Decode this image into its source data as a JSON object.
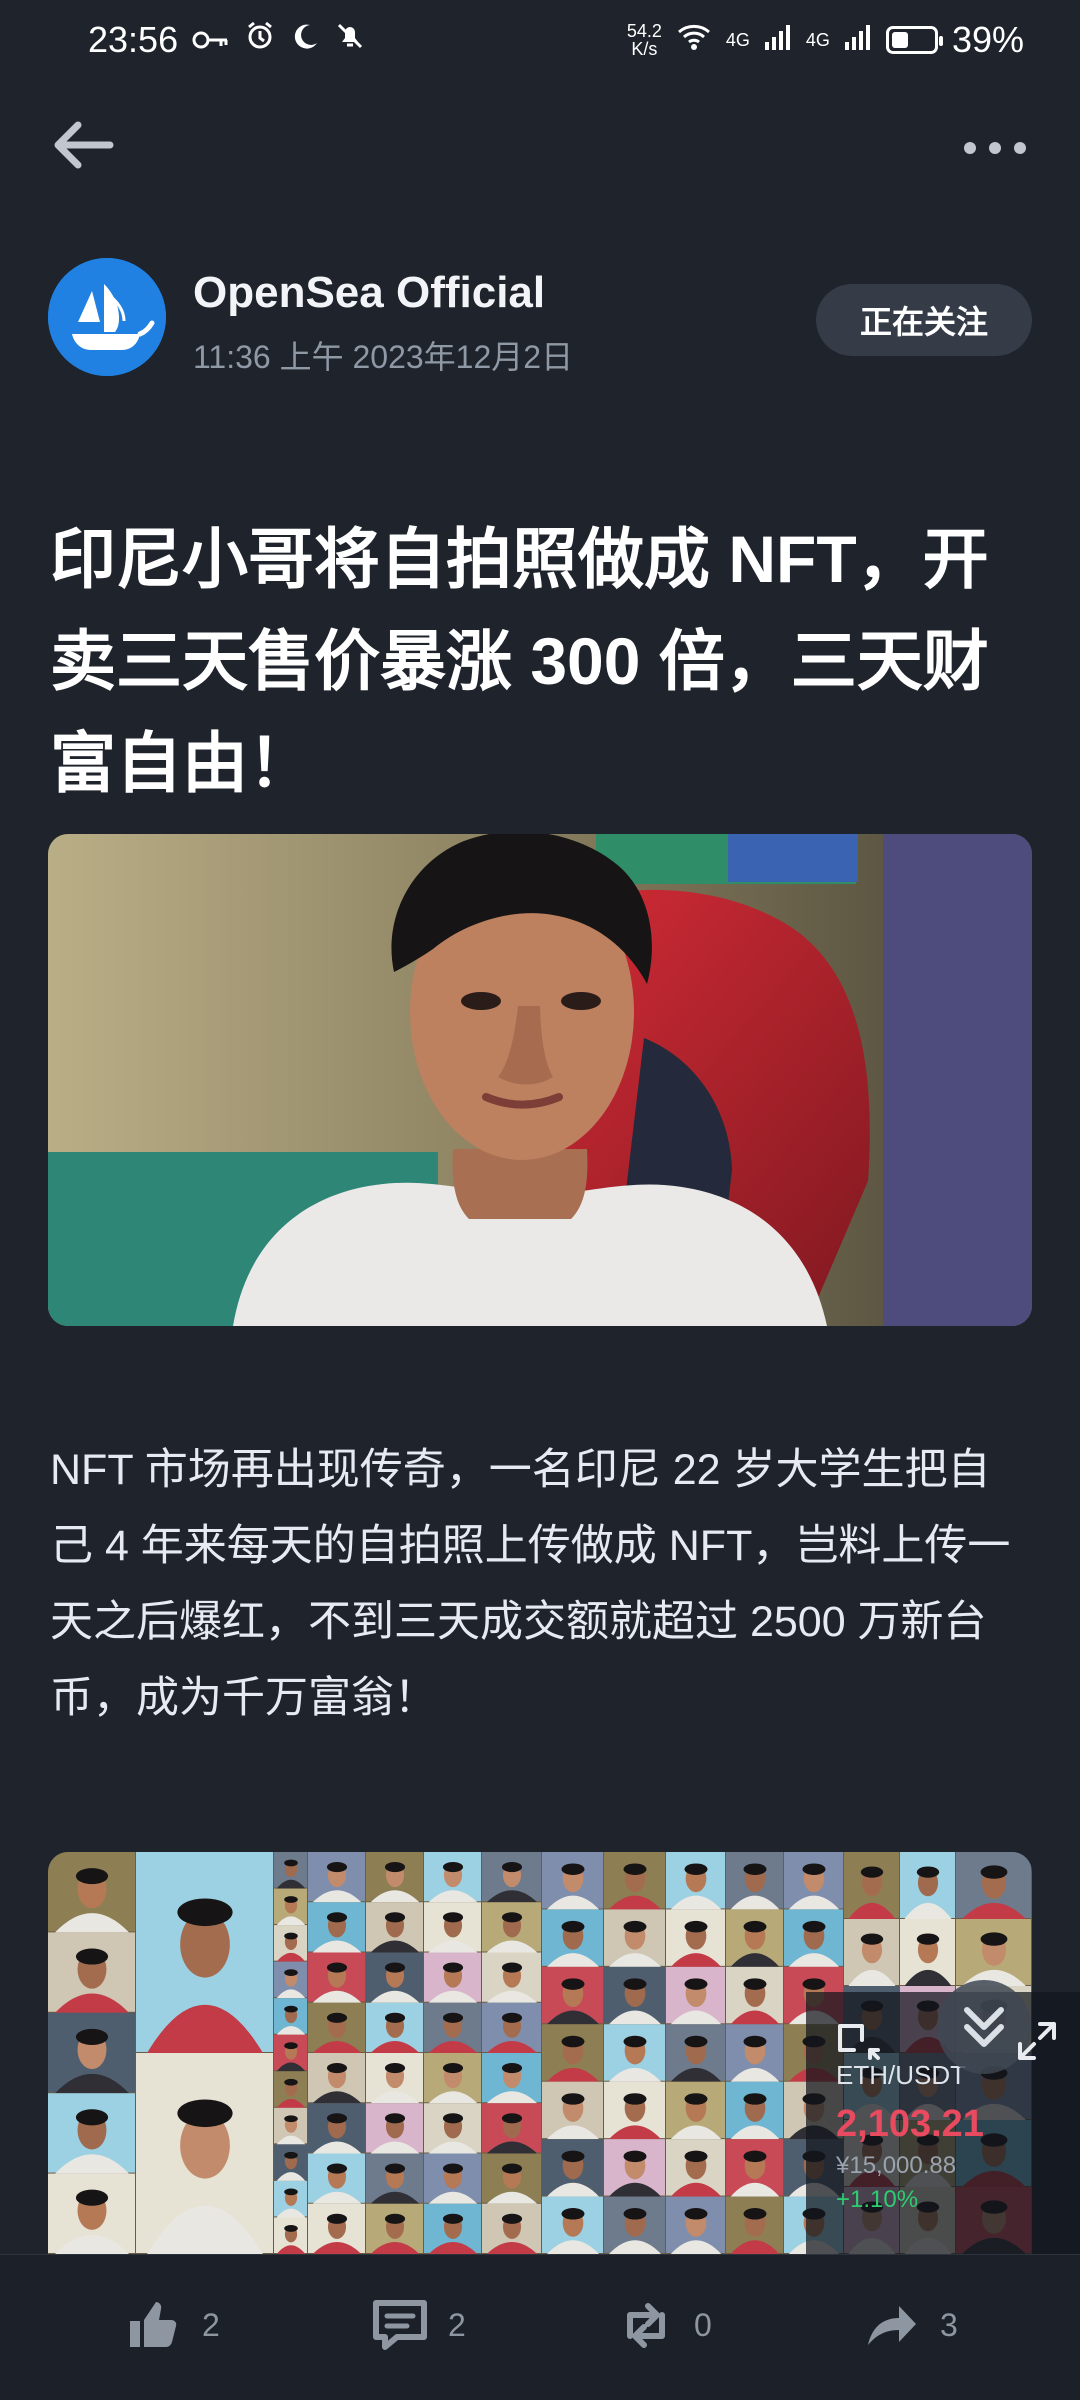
{
  "status_bar": {
    "time": "23:56",
    "network_speed": "54.2",
    "network_unit": "K/s",
    "network_type_1": "4G",
    "network_type_2": "4G",
    "battery_percent": "39%",
    "battery_level": 0.39
  },
  "author": {
    "name": "OpenSea Official",
    "timestamp": "11:36 上午 2023年12月2日",
    "follow_label": "正在关注"
  },
  "article": {
    "title": "印尼小哥将自拍照做成 NFT，开卖三天售价暴涨 300 倍，三天财富自由！",
    "body": "NFT 市场再出现传奇，一名印尼 22 岁大学生把自己 4 年来每天的自拍照上传做成 NFT，岂料上传一天之后爆红，不到三天成交额就超过 2500 万新台币，成为千万富翁！"
  },
  "price_widget": {
    "pair": "ETH/USDT",
    "price": "2,103.21",
    "cny": "¥15,000.88",
    "change": "+1.10%"
  },
  "actions": {
    "like_count": "2",
    "comment_count": "2",
    "repost_count": "0",
    "share_count": "3"
  },
  "icons": {
    "back": "arrow-left-icon",
    "more": "more-horizontal-icon",
    "like": "thumbs-up-icon",
    "comment": "comment-icon",
    "repost": "repost-icon",
    "share": "share-icon",
    "collapse": "double-chevron-down-icon",
    "shrink": "shrink-icon",
    "expand": "expand-icon"
  },
  "colors": {
    "background": "#1e232c",
    "brand_blue": "#2081e2",
    "price_down_red": "#e84a5f",
    "change_green": "#2ecc71"
  }
}
